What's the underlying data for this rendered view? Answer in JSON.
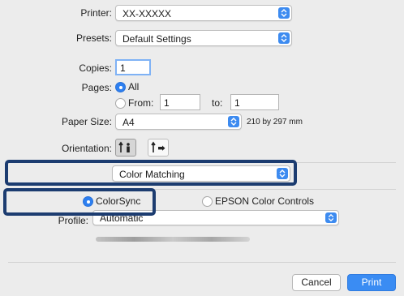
{
  "printer": {
    "label": "Printer:",
    "value": "XX-XXXXX"
  },
  "presets": {
    "label": "Presets:",
    "value": "Default Settings"
  },
  "copies": {
    "label": "Copies:",
    "value": "1"
  },
  "pages": {
    "label": "Pages:",
    "all_label": "All",
    "from_label": "From:",
    "from_value": "1",
    "to_label": "to:",
    "to_value": "1",
    "selected": "All"
  },
  "paper_size": {
    "label": "Paper Size:",
    "value": "A4",
    "dimensions": "210 by 297 mm"
  },
  "orientation": {
    "label": "Orientation:",
    "options": [
      "portrait-icon",
      "landscape-icon"
    ],
    "selected": "portrait"
  },
  "panel": {
    "value": "Color Matching"
  },
  "color_mode": {
    "options": [
      "ColorSync",
      "EPSON Color Controls"
    ],
    "selected": "ColorSync"
  },
  "profile": {
    "label": "Profile:",
    "value": "Automatic"
  },
  "buttons": {
    "cancel": "Cancel",
    "print": "Print"
  },
  "colors": {
    "accent": "#3a8cf3",
    "highlight_frame": "#1c3c70",
    "background": "#ececec"
  }
}
